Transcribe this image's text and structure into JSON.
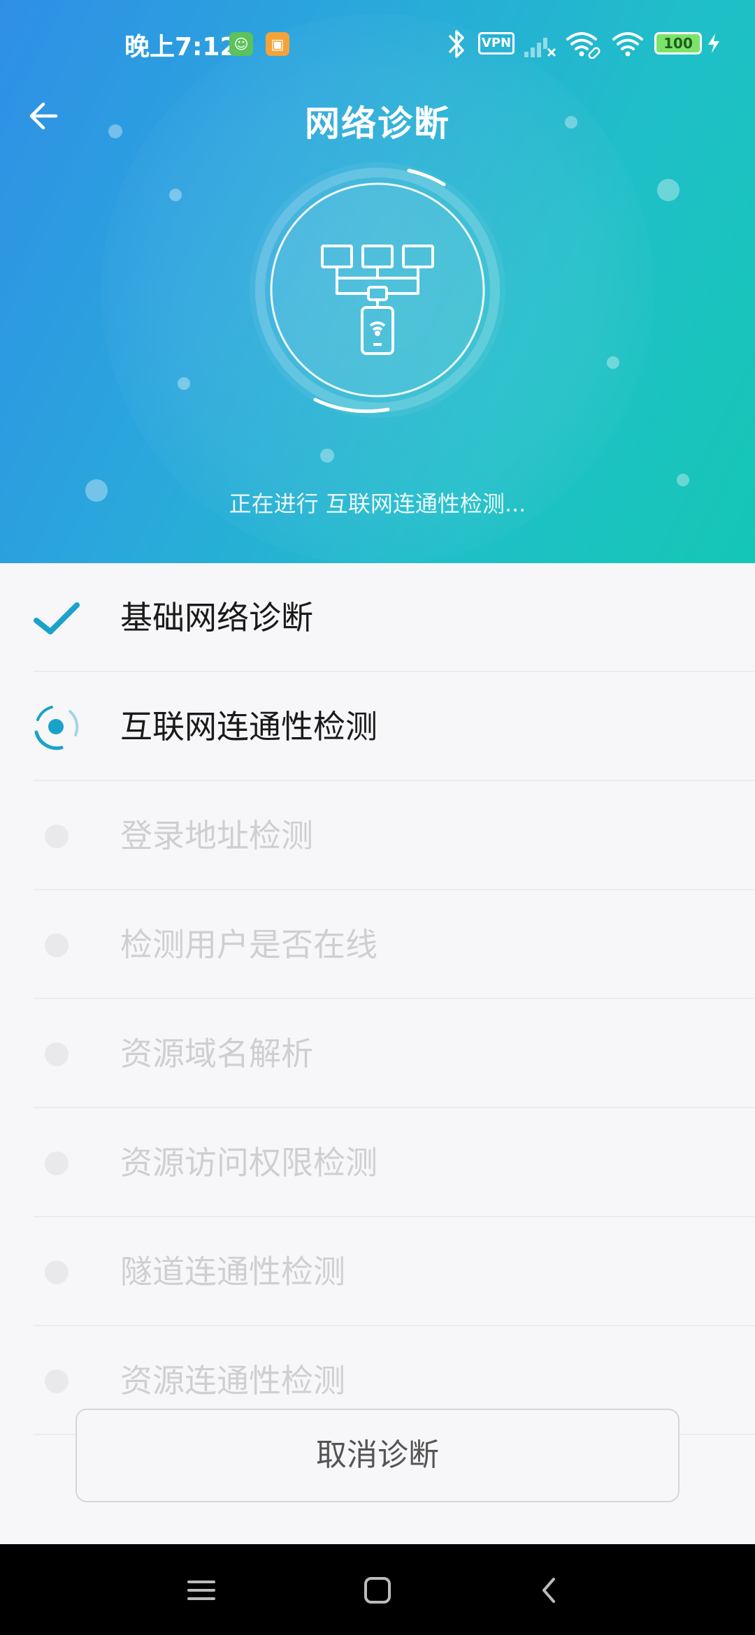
{
  "statusbar": {
    "time": "晚上7:12",
    "vpn_label": "VPN",
    "battery": "100",
    "icons": [
      "android-app-icon",
      "calendar-app-icon",
      "bluetooth-icon",
      "vpn-icon",
      "signal-off-icon",
      "wifi-link-icon",
      "wifi-icon",
      "battery-icon",
      "charging-icon"
    ]
  },
  "header": {
    "title": "网络诊断",
    "status_text": "正在进行 互联网连通性检测...",
    "diagram_icon": "network-diagnosis-icon"
  },
  "checks": [
    {
      "label": "基础网络诊断",
      "state": "done"
    },
    {
      "label": "互联网连通性检测",
      "state": "running"
    },
    {
      "label": "登录地址检测",
      "state": "pending"
    },
    {
      "label": "检测用户是否在线",
      "state": "pending"
    },
    {
      "label": "资源域名解析",
      "state": "pending"
    },
    {
      "label": "资源访问权限检测",
      "state": "pending"
    },
    {
      "label": "隧道连通性检测",
      "state": "pending"
    },
    {
      "label": "资源连通性检测",
      "state": "pending"
    }
  ],
  "actions": {
    "cancel_label": "取消诊断"
  },
  "colors": {
    "accent": "#1aa3c8",
    "header_gradient_start": "#2f8fe6",
    "header_gradient_end": "#14c7b4",
    "pending_text": "#cfcfd2"
  }
}
